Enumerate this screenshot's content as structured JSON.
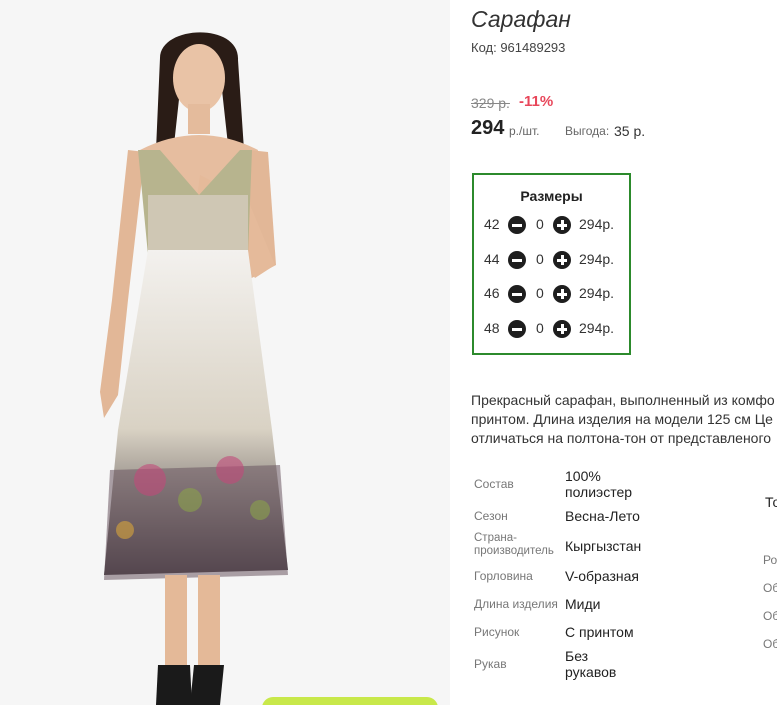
{
  "product": {
    "title": "Сарафан",
    "code": "Код: 961489293",
    "old_price": "329 р.",
    "discount": "-11%",
    "price": "294",
    "price_unit": "р./шт.",
    "savings_label": "Выгода:",
    "savings_value": "35 р."
  },
  "sizes": {
    "title": "Размеры",
    "rows": [
      {
        "size": "42",
        "qty": "0",
        "price": "294р."
      },
      {
        "size": "44",
        "qty": "0",
        "price": "294р."
      },
      {
        "size": "46",
        "qty": "0",
        "price": "294р."
      },
      {
        "size": "48",
        "qty": "0",
        "price": "294р."
      }
    ]
  },
  "description": {
    "lines": [
      "Прекрасный сарафан, выполненный из комфо",
      "принтом. Длина изделия на модели 125 см Це",
      "отличаться на полтона-тон от представленого"
    ]
  },
  "attributes": [
    {
      "label": "Состав",
      "value": "100% полиэстер"
    },
    {
      "label": "Сезон",
      "value": "Весна-Лето"
    },
    {
      "label": "Страна-производитель",
      "value": "Кыргызстан"
    },
    {
      "label": "Горловина",
      "value": "V-образная"
    },
    {
      "label": "Длина изделия",
      "value": "Миди"
    },
    {
      "label": "Рисунок",
      "value": "С принтом"
    },
    {
      "label": "Рукав",
      "value": "Без рукавов"
    }
  ],
  "cut_off": {
    "title_partial": "То",
    "labels": [
      "Ро",
      "Об",
      "Об",
      "Об"
    ]
  },
  "colors": {
    "accent_green": "#2c8a2c",
    "discount_red": "#e8465a",
    "buy_button": "#c8e84a"
  }
}
